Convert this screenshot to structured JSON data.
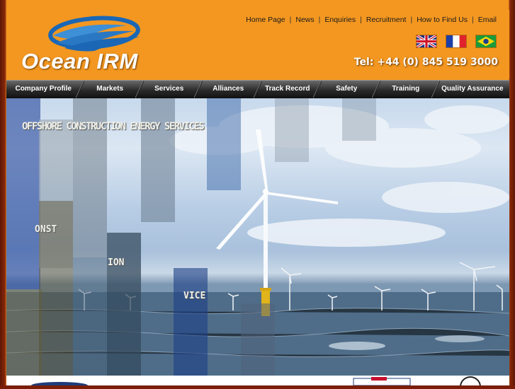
{
  "brand": {
    "name": "Ocean IRM"
  },
  "top_links": [
    "Home Page",
    "News",
    "Enquiries",
    "Recruitment",
    "How to Find Us",
    "Email"
  ],
  "phone": "Tel: +44 (0) 845 519 3000",
  "flags": [
    {
      "name": "uk-flag-icon",
      "label": "English"
    },
    {
      "name": "france-flag-icon",
      "label": "French"
    },
    {
      "name": "brazil-flag-icon",
      "label": "Portuguese"
    }
  ],
  "nav": [
    "Company Profile",
    "Markets",
    "Services",
    "Alliances",
    "Track Record",
    "Safety",
    "Training",
    "Quality Assurance"
  ],
  "hero": {
    "text_fragments": [
      "OFFSHORE CONSTRUCTION ENERGY SERVICES",
      "ONST",
      "ION",
      "VICE"
    ]
  },
  "colors": {
    "accent": "#f39720",
    "nav": "#2a2a2a",
    "frame": "#7a1e08"
  }
}
